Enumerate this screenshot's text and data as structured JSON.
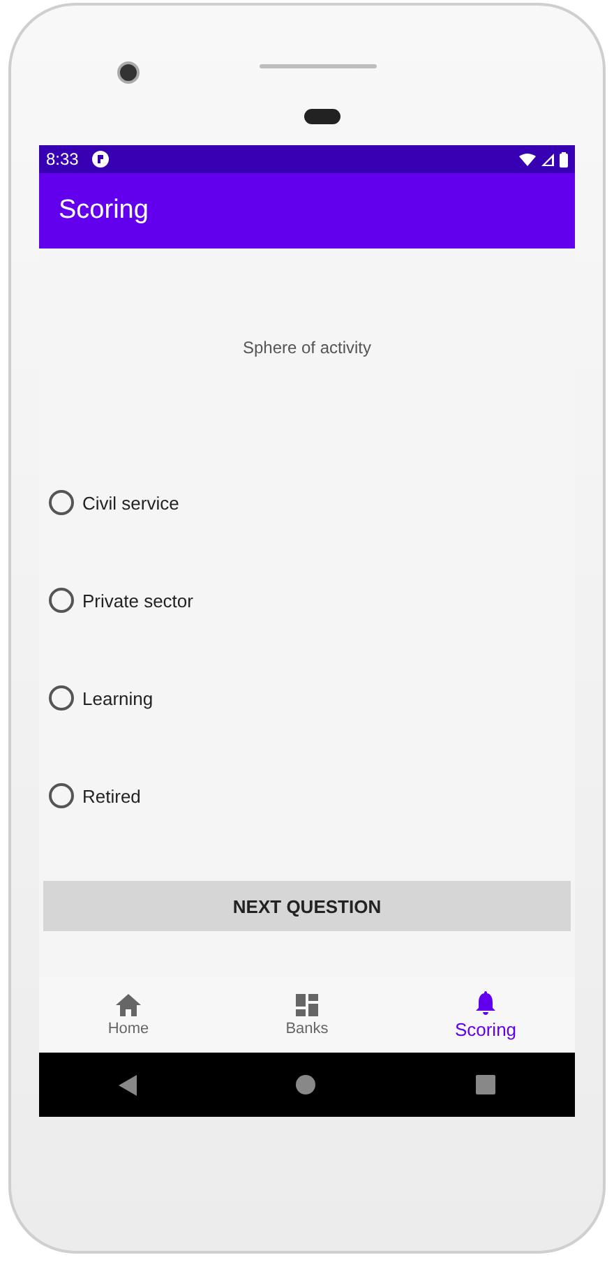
{
  "status_bar": {
    "time": "8:33"
  },
  "app_bar": {
    "title": "Scoring"
  },
  "question": "Sphere of activity",
  "options": [
    {
      "label": "Civil service",
      "selected": false
    },
    {
      "label": "Private sector",
      "selected": false
    },
    {
      "label": "Learning",
      "selected": false
    },
    {
      "label": "Retired",
      "selected": false
    }
  ],
  "button": "NEXT QUESTION",
  "bottom_nav": [
    {
      "label": "Home",
      "selected": false
    },
    {
      "label": "Banks",
      "selected": false
    },
    {
      "label": "Scoring",
      "selected": true
    }
  ]
}
